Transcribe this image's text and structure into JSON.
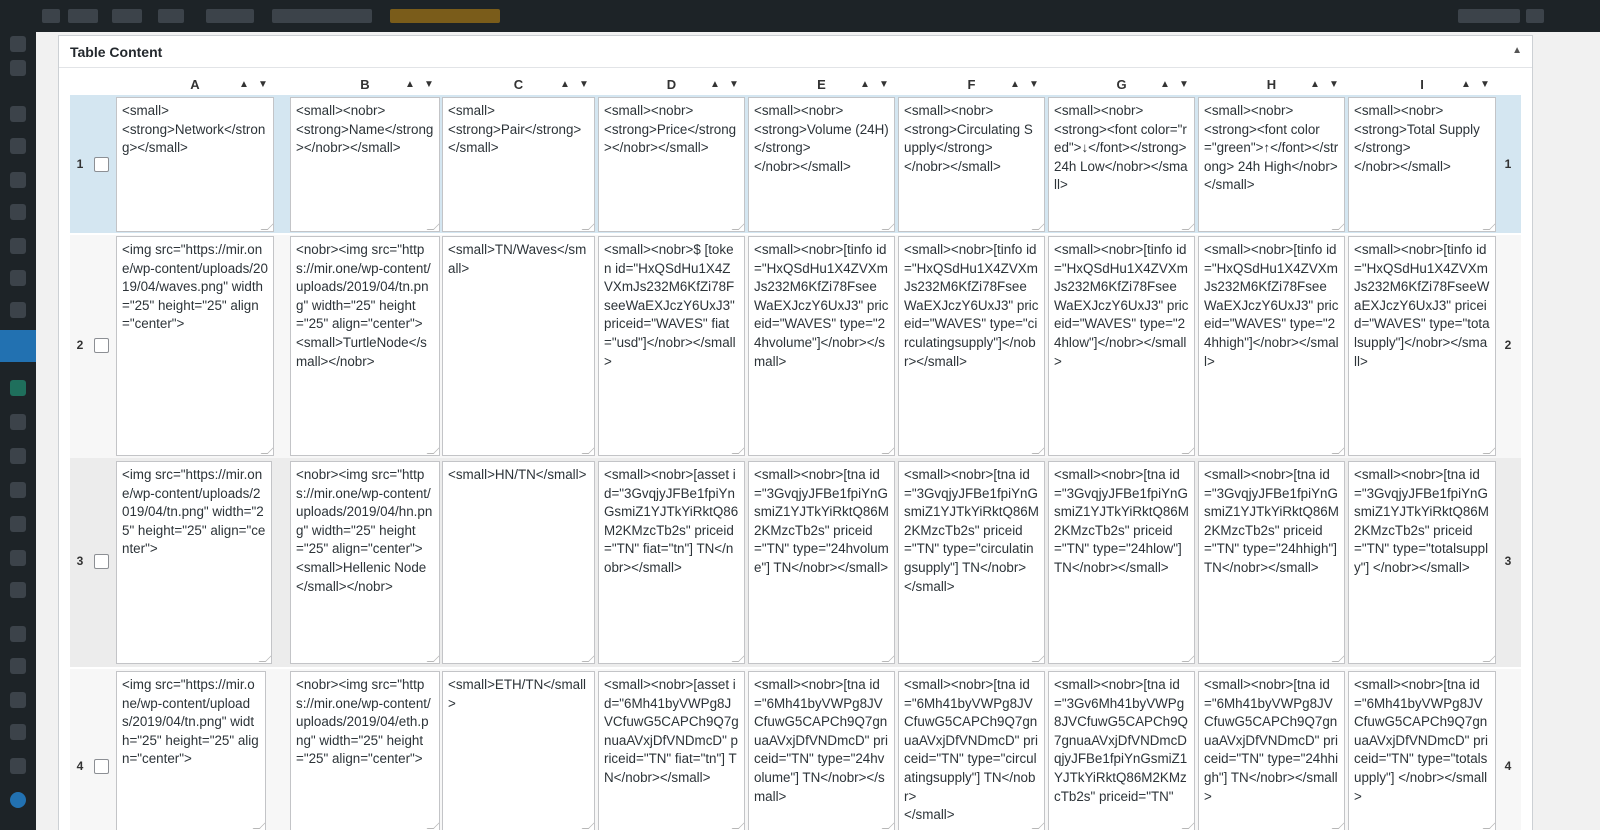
{
  "panel": {
    "title": "Table Content",
    "collapse_glyph": "▲"
  },
  "columns": [
    "A",
    "B",
    "C",
    "D",
    "E",
    "F",
    "G",
    "H",
    "I"
  ],
  "sort_glyphs": {
    "up": "▲",
    "down": "▼"
  },
  "rows": [
    {
      "number": "1",
      "cells": [
        "<small>\n<strong>Network</strong></small>",
        "<small><nobr>\n<strong>Name</strong></nobr></small>",
        "<small>\n<strong>Pair</strong>\n</small>",
        "<small><nobr>\n<strong>Price</strong></nobr></small>",
        "<small><nobr>\n<strong>Volume (24H)</strong>\n</nobr></small>",
        "<small><nobr>\n<strong>Circulating Supply</strong>\n</nobr></small>",
        "<small><nobr>\n<strong><font color=\"red\">↓</font></strong> 24h Low</nobr></small>",
        "<small><nobr>\n<strong><font color=\"green\">↑</font></strong> 24h High</nobr></small>",
        "<small><nobr>\n<strong>Total Supply</strong>\n</nobr></small>"
      ]
    },
    {
      "number": "2",
      "cells": [
        "<img src=\"https://mir.one/wp-content/uploads/2019/04/waves.png\" width=\"25\" height=\"25\" align=\"center\">",
        "<nobr><img src=\"https://mir.one/wp-content/uploads/2019/04/tn.png\" width=\"25\" height=\"25\" align=\"center\">\n<small>TurtleNode</small></nobr>",
        "<small>TN/Waves</small>",
        "<small><nobr>$ [token id=\"HxQSdHu1X4ZVXmJs232M6KfZi78FseeWaEXJczY6UxJ3\" priceid=\"WAVES\" fiat=\"usd\"]</nobr></small>",
        "<small><nobr>[tinfo id=\"HxQSdHu1X4ZVXmJs232M6KfZi78FseeWaEXJczY6UxJ3\" priceid=\"WAVES\" type=\"24hvolume\"]</nobr></small>",
        "<small><nobr>[tinfo id=\"HxQSdHu1X4ZVXmJs232M6KfZi78FseeWaEXJczY6UxJ3\" priceid=\"WAVES\" type=\"circulatingsupply\"]</nobr></small>",
        "<small><nobr>[tinfo id=\"HxQSdHu1X4ZVXmJs232M6KfZi78FseeWaEXJczY6UxJ3\" priceid=\"WAVES\" type=\"24hlow\"]</nobr></small>",
        "<small><nobr>[tinfo id=\"HxQSdHu1X4ZVXmJs232M6KfZi78FseeWaEXJczY6UxJ3\" priceid=\"WAVES\" type=\"24hhigh\"]</nobr></small>",
        "<small><nobr>[tinfo id=\"HxQSdHu1X4ZVXmJs232M6KfZi78FseeWaEXJczY6UxJ3\" priceid=\"WAVES\" type=\"totalsupply\"]</nobr></small>"
      ]
    },
    {
      "number": "3",
      "cells": [
        "<img src=\"https://mir.one/wp-content/uploads/2019/04/tn.png\" width=\"25\" height=\"25\" align=\"center\">",
        "<nobr><img src=\"https://mir.one/wp-content/uploads/2019/04/hn.png\" width=\"25\" height=\"25\" align=\"center\">\n<small>Hellenic Node</small></nobr>",
        "<small>HN/TN</small>",
        "<small><nobr>[asset id=\"3GvqjyJFBe1fpiYnGsmiZ1YJTkYiRktQ86M2KMzcTb2s\" priceid=\"TN\" fiat=\"tn\"] TN</nobr></small>",
        "<small><nobr>[tna id=\"3GvqjyJFBe1fpiYnGsmiZ1YJTkYiRktQ86M2KMzcTb2s\" priceid=\"TN\" type=\"24hvolume\"] TN</nobr></small>",
        "<small><nobr>[tna id=\"3GvqjyJFBe1fpiYnGsmiZ1YJTkYiRktQ86M2KMzcTb2s\" priceid=\"TN\" type=\"circulatingsupply\"] TN</nobr>\n</small>",
        "<small><nobr>[tna id=\"3GvqjyJFBe1fpiYnGsmiZ1YJTkYiRktQ86M2KMzcTb2s\" priceid=\"TN\" type=\"24hlow\"] TN</nobr></small>",
        "<small><nobr>[tna id=\"3GvqjyJFBe1fpiYnGsmiZ1YJTkYiRktQ86M2KMzcTb2s\" priceid=\"TN\" type=\"24hhigh\"] TN</nobr></small>",
        "<small><nobr>[tna id=\"3GvqjyJFBe1fpiYnGsmiZ1YJTkYiRktQ86M2KMzcTb2s\" priceid=\"TN\" type=\"totalsupply\"] </nobr></small>"
      ]
    },
    {
      "number": "4",
      "cells": [
        "<img src=\"https://mir.one/wp-content/uploads/2019/04/tn.png\" width=\"25\" height=\"25\" align=\"center\">",
        "<nobr><img src=\"https://mir.one/wp-content/uploads/2019/04/eth.png\" width=\"25\" height=\"25\" align=\"center\">",
        "<small>ETH/TN</small>",
        "<small><nobr>[asset id=\"6Mh41byVWPg8JVCfuwG5CAPCh9Q7gnuaAVxjDfVNDmcD\" priceid=\"TN\" fiat=\"tn\"] TN</nobr></small>",
        "<small><nobr>[tna id=\"6Mh41byVWPg8JVCfuwG5CAPCh9Q7gnuaAVxjDfVNDmcD\" priceid=\"TN\" type=\"24hvolume\"] TN</nobr></small>",
        "<small><nobr>[tna id=\"6Mh41byVWPg8JVCfuwG5CAPCh9Q7gnuaAVxjDfVNDmcD\" priceid=\"TN\" type=\"circulatingsupply\"] TN</nobr>\n</small>",
        "<small><nobr>[tna id=\"3Gv6Mh41byVWPg8JVCfuwG5CAPCh9Q7gnuaAVxjDfVNDmcDqjyJFBe1fpiYnGsmiZ1YJTkYiRktQ86M2KMzcTb2s\" priceid=\"TN\"",
        "<small><nobr>[tna id=\"6Mh41byVWPg8JVCfuwG5CAPCh9Q7gnuaAVxjDfVNDmcD\" priceid=\"TN\" type=\"24hhigh\"] TN</nobr></small>",
        "<small><nobr>[tna id=\"6Mh41byVWPg8JVCfuwG5CAPCh9Q7gnuaAVxjDfVNDmcD\" priceid=\"TN\" type=\"totalsupply\"] </nobr></small>"
      ]
    }
  ],
  "colors": {
    "selected_row": "#d4e6f1",
    "alt_row": "#ececec",
    "admin_bar": "#1d2327",
    "active_menu": "#2271b1"
  }
}
